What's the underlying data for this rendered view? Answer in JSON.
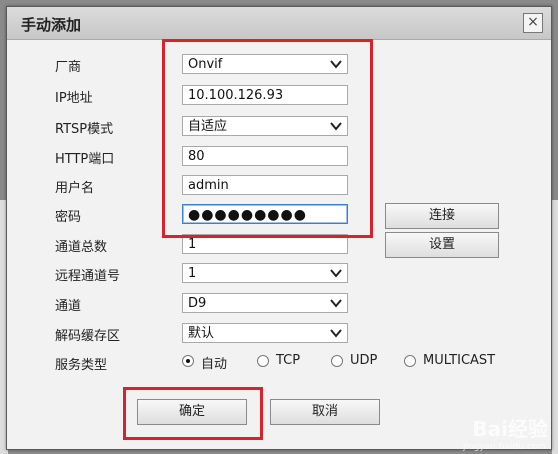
{
  "dialog": {
    "title": "手动添加",
    "close_glyph": "×"
  },
  "form": {
    "vendor": {
      "label": "厂商",
      "value": "Onvif"
    },
    "ip": {
      "label": "IP地址",
      "value": "10.100.126.93"
    },
    "rtsp_mode": {
      "label": "RTSP模式",
      "value": "自适应"
    },
    "http_port": {
      "label": "HTTP端口",
      "value": "80"
    },
    "username": {
      "label": "用户名",
      "value": "admin"
    },
    "password": {
      "label": "密码",
      "value": "●●●●●●●●●"
    },
    "channel_total": {
      "label": "通道总数",
      "value": "1"
    },
    "remote_channel": {
      "label": "远程通道号",
      "value": "1"
    },
    "channel": {
      "label": "通道",
      "value": "D9"
    },
    "decode_buffer": {
      "label": "解码缓存区",
      "value": "默认"
    },
    "service_type": {
      "label": "服务类型",
      "options": [
        "自动",
        "TCP",
        "UDP",
        "MULTICAST"
      ],
      "selected": "自动"
    }
  },
  "side_buttons": {
    "connect": "连接",
    "settings": "设置"
  },
  "bottom_buttons": {
    "confirm": "确定",
    "cancel": "取消"
  },
  "watermark": {
    "brand": "Bai经验",
    "url": "jingyan.baidu.com"
  },
  "colors": {
    "highlight": "#d9232a",
    "focus": "#3a7fd5"
  }
}
